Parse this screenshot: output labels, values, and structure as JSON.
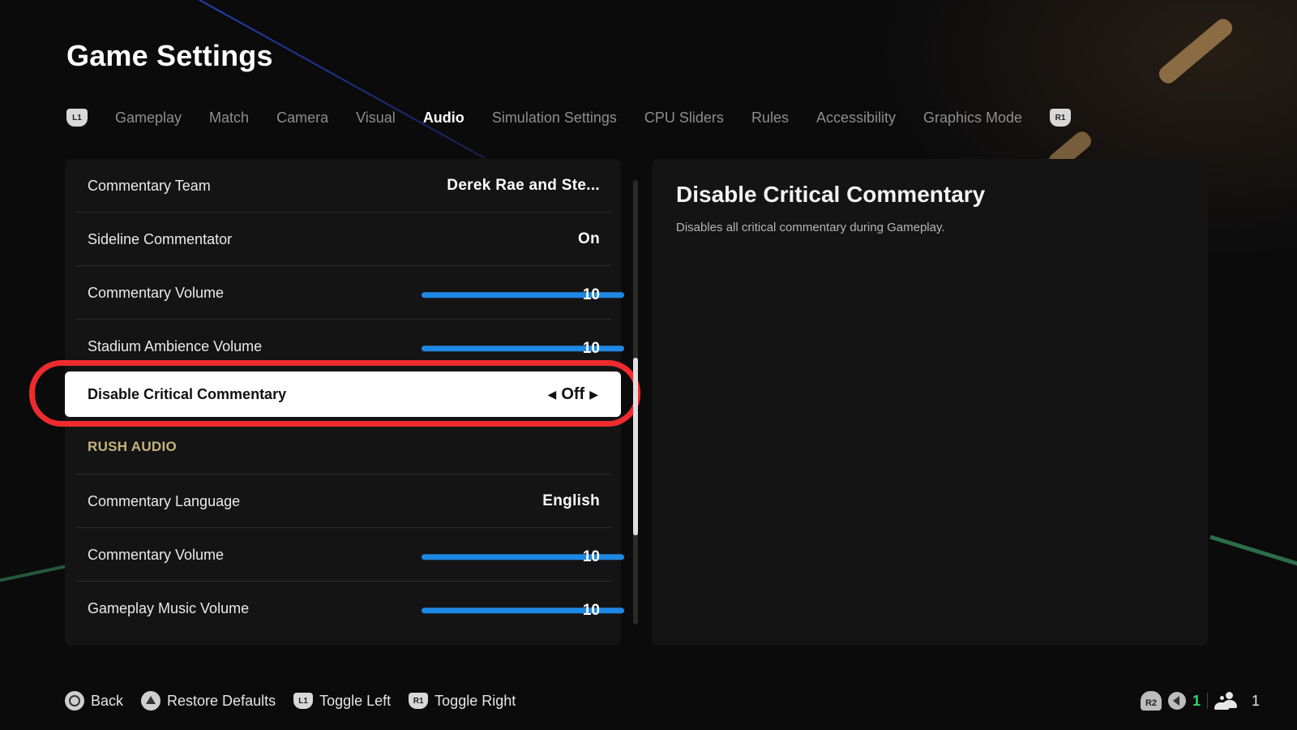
{
  "page": {
    "title": "Game Settings"
  },
  "tabs": {
    "left_bumper": "L1",
    "right_bumper": "R1",
    "items": [
      {
        "label": "Gameplay",
        "active": false
      },
      {
        "label": "Match",
        "active": false
      },
      {
        "label": "Camera",
        "active": false
      },
      {
        "label": "Visual",
        "active": false
      },
      {
        "label": "Audio",
        "active": true
      },
      {
        "label": "Simulation Settings",
        "active": false
      },
      {
        "label": "CPU Sliders",
        "active": false
      },
      {
        "label": "Rules",
        "active": false
      },
      {
        "label": "Accessibility",
        "active": false
      },
      {
        "label": "Graphics Mode",
        "active": false
      }
    ]
  },
  "settings": {
    "rows": [
      {
        "label": "Commentary Team",
        "type": "value",
        "value": "Derek Rae and Ste..."
      },
      {
        "label": "Sideline Commentator",
        "type": "value",
        "value": "On"
      },
      {
        "label": "Commentary Volume",
        "type": "slider",
        "value": "10",
        "fraction": 1.0
      },
      {
        "label": "Stadium Ambience Volume",
        "type": "slider",
        "value": "10",
        "fraction": 1.0
      },
      {
        "label": "Disable Critical Commentary",
        "type": "selector",
        "value": "Off",
        "selected": true
      },
      {
        "label": "RUSH AUDIO",
        "type": "section"
      },
      {
        "label": "Commentary Language",
        "type": "value",
        "value": "English"
      },
      {
        "label": "Commentary Volume",
        "type": "slider",
        "value": "10",
        "fraction": 1.0
      },
      {
        "label": "Gameplay Music Volume",
        "type": "slider",
        "value": "10",
        "fraction": 1.0
      }
    ],
    "selector_left_icon": "◀",
    "selector_right_icon": "▶",
    "scroll": {
      "thumb_start_fraction": 0.4,
      "thumb_end_fraction": 0.8
    }
  },
  "description": {
    "title": "Disable Critical Commentary",
    "text": "Disables all critical commentary during Gameplay."
  },
  "footer": {
    "hints": [
      {
        "button": "circle",
        "label": "Back"
      },
      {
        "button": "triangle",
        "label": "Restore Defaults"
      },
      {
        "button": "L1",
        "label": "Toggle Left"
      },
      {
        "button": "R1",
        "label": "Toggle Right"
      }
    ]
  },
  "status": {
    "r2_badge": "R2",
    "voice_count": "1",
    "party_count": "1"
  },
  "colors": {
    "accent_blue": "#1e88e5",
    "highlight_red": "#ee2b2f",
    "section_gold": "#c7b27a",
    "voice_green": "#36d36a"
  }
}
